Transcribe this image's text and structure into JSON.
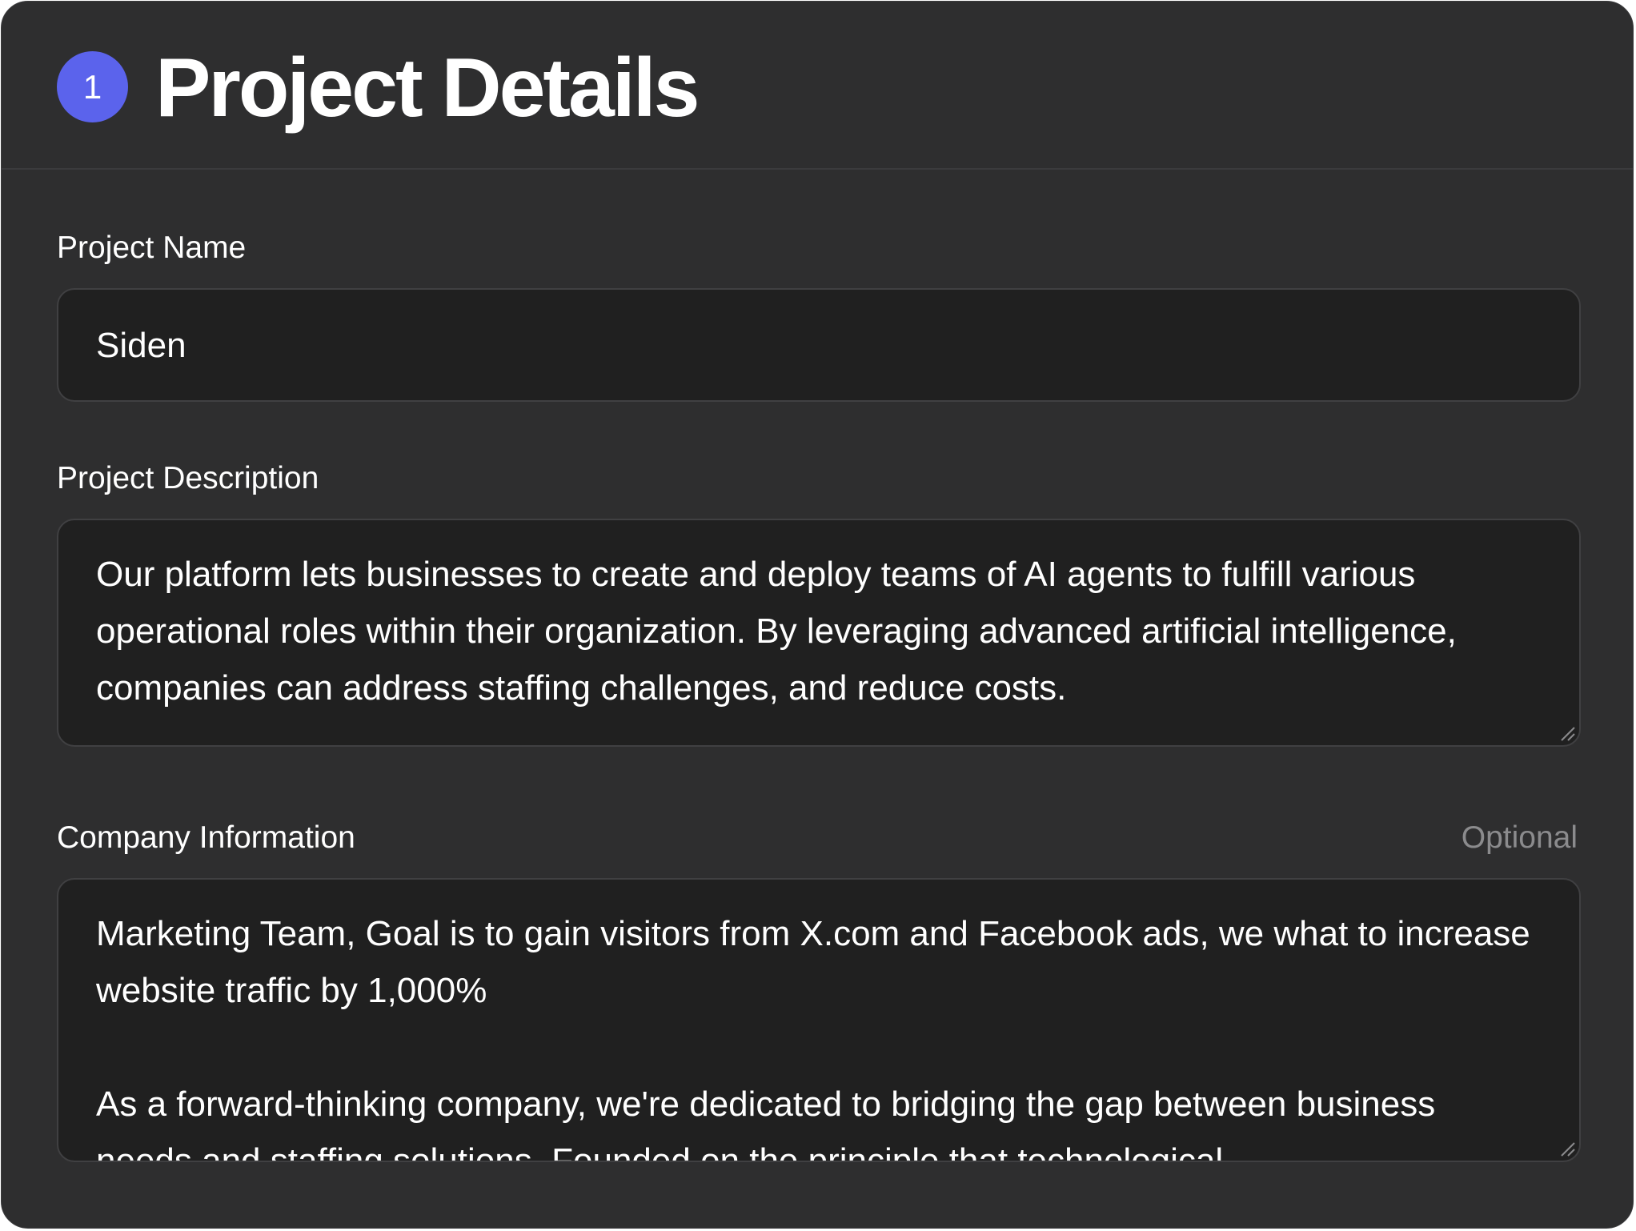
{
  "header": {
    "step_number": "1",
    "title": "Project Details"
  },
  "fields": {
    "project_name": {
      "label": "Project Name",
      "value": "Siden"
    },
    "project_description": {
      "label": "Project Description",
      "value": "Our platform lets businesses to create and deploy teams of AI agents to fulfill various operational roles within their organization. By leveraging advanced artificial intelligence, companies can address staffing challenges, and reduce costs."
    },
    "company_information": {
      "label": "Company Information",
      "optional_label": "Optional",
      "value": "Marketing Team, Goal is to gain visitors from X.com and Facebook ads, we what to increase website traffic by 1,000%\n\nAs a forward-thinking company, we're dedicated to bridging the gap between business needs and staffing solutions. Founded on the principle that technological"
    }
  },
  "colors": {
    "card_background": "#2e2e2f",
    "input_background": "#202020",
    "accent": "#5b63ec",
    "muted_text": "#8b8b8d"
  }
}
